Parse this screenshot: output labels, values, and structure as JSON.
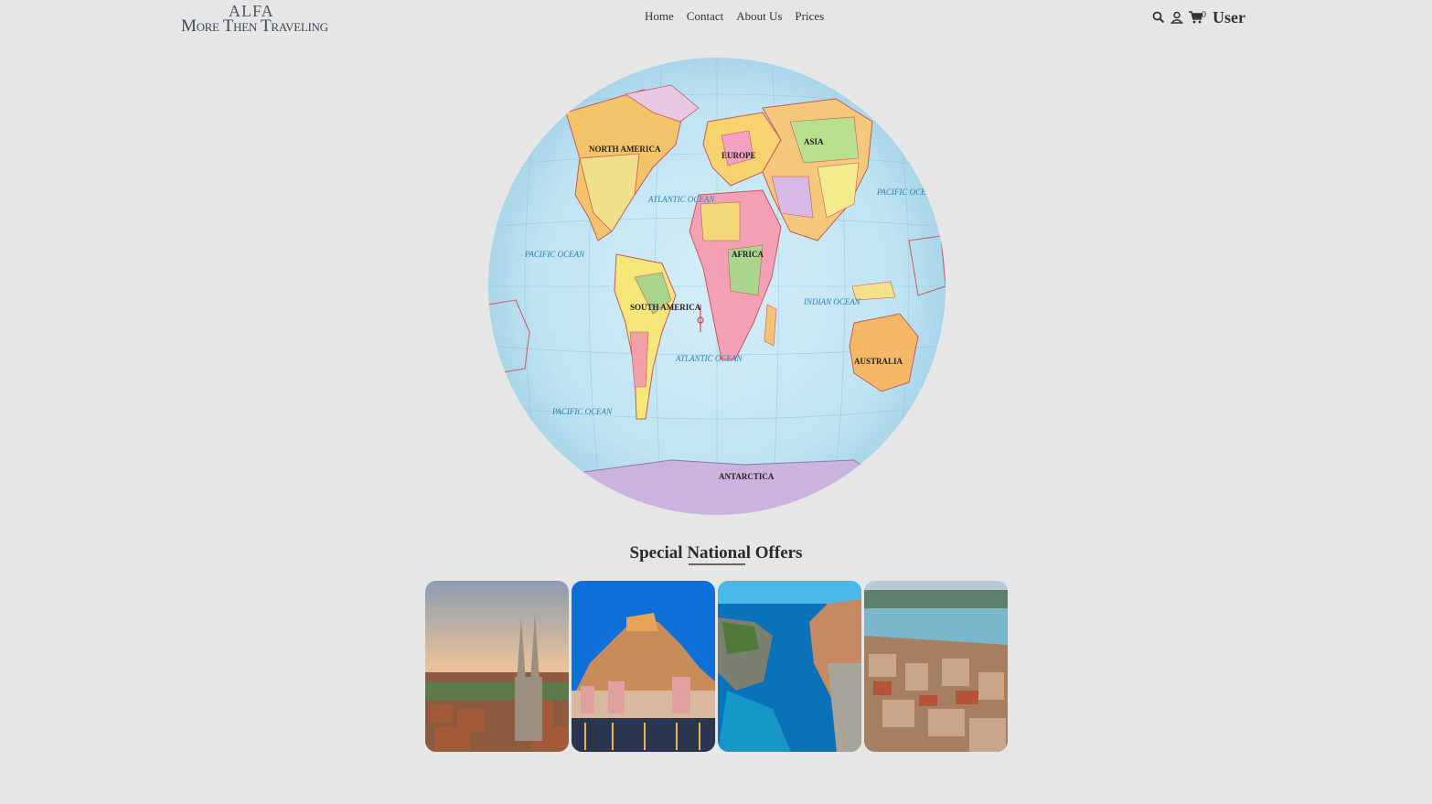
{
  "header": {
    "logo_line1": "ALFA",
    "logo_line2": "More Then Traveling",
    "nav": [
      "Home",
      "Contact",
      "About Us",
      "Prices"
    ],
    "cart_count": "0",
    "user_label": "User"
  },
  "map": {
    "labels": {
      "north_america": "NORTH AMERICA",
      "south_america": "SOUTH AMERICA",
      "europe": "EUROPE",
      "asia": "ASIA",
      "africa": "AFRICA",
      "australia": "AUSTRALIA",
      "antarctica": "ANTARCTICA",
      "atlantic_n": "ATLANTIC OCEAN",
      "atlantic_s": "ATLANTIC OCEAN",
      "pacific_w": "PACIFIC OCEAN",
      "pacific_sw": "PACIFIC OCEAN",
      "pacific_e": "PACIFIC OCEAN",
      "indian": "INDIAN OCEAN"
    }
  },
  "offers": {
    "title": "Special National Offers",
    "cards": [
      {
        "name": "cathedral-city"
      },
      {
        "name": "hilltop-town-night"
      },
      {
        "name": "coastal-cliffs"
      },
      {
        "name": "old-town-harbor"
      }
    ]
  },
  "colors": {
    "background": "#e6e6e6",
    "ocean": "#bfe4f2",
    "text": "#333333"
  }
}
